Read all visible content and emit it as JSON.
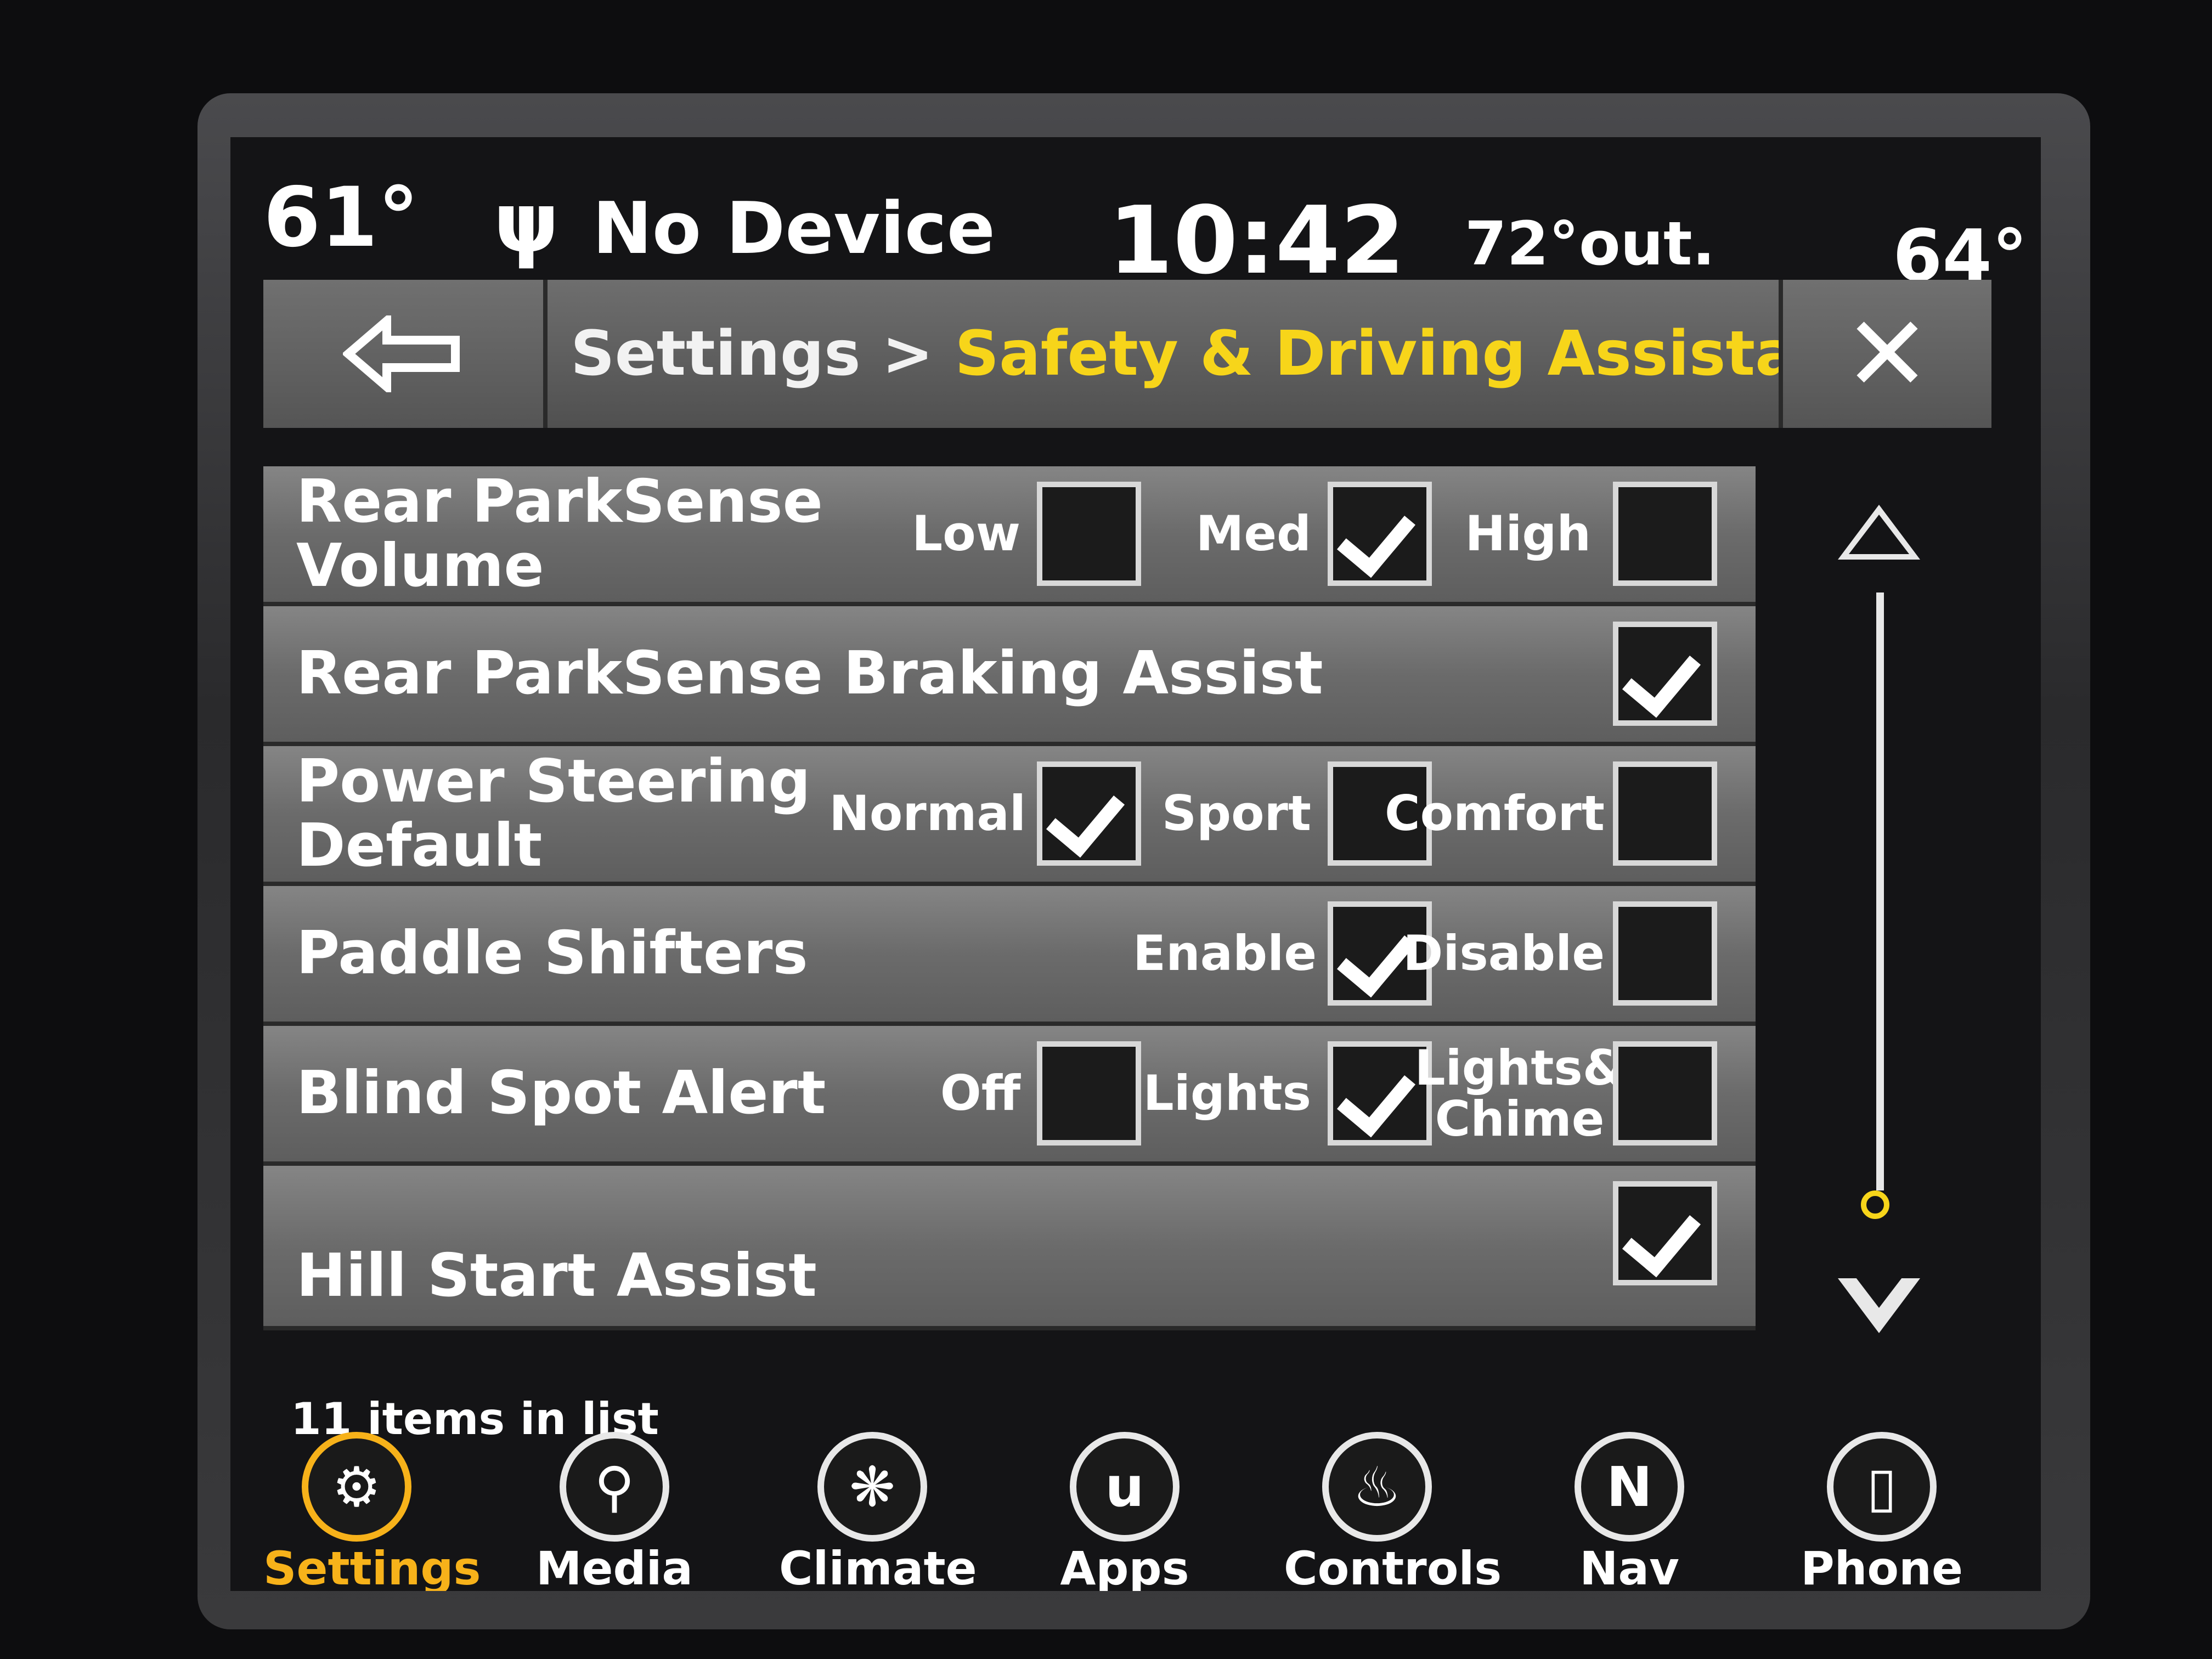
{
  "status": {
    "inside_temp_left": "61°",
    "usb_icon": "usb-icon",
    "device": "No Device",
    "time": "10:42",
    "outside_temp": "72°out.",
    "inside_temp_right": "64°"
  },
  "header": {
    "back_icon": "back-arrow-icon",
    "breadcrumb_root": "Settings",
    "breadcrumb_sep": " > ",
    "breadcrumb_current": "Safety & Driving Assistance",
    "close_icon": "close-icon",
    "close_glyph": "✕"
  },
  "colors": {
    "accent": "#f7d51a",
    "nav_active": "#f7b21a",
    "row": "#6b6b6b"
  },
  "rows": [
    {
      "label": "Rear ParkSense Volume",
      "options": [
        {
          "label": "Low",
          "checked": false
        },
        {
          "label": "Med",
          "checked": true
        },
        {
          "label": "High",
          "checked": false
        }
      ]
    },
    {
      "label": "Rear ParkSense Braking Assist",
      "options": [
        {
          "label": "",
          "checked": true
        }
      ]
    },
    {
      "label": "Power Steering Default",
      "options": [
        {
          "label": "Normal",
          "checked": true
        },
        {
          "label": "Sport",
          "checked": false
        },
        {
          "label": "Comfort",
          "checked": false
        }
      ]
    },
    {
      "label": "Paddle Shifters",
      "options": [
        {
          "label": "Enable",
          "checked": true
        },
        {
          "label": "Disable",
          "checked": false
        }
      ]
    },
    {
      "label": "Blind Spot Alert",
      "options": [
        {
          "label": "Off",
          "checked": false
        },
        {
          "label": "Lights",
          "checked": true
        },
        {
          "label": "Lights& Chime",
          "checked": false
        }
      ]
    },
    {
      "label": "Hill Start Assist",
      "options": [
        {
          "label": "",
          "checked": true
        }
      ]
    }
  ],
  "list_count": "11 items in list",
  "nav": [
    {
      "label": "Settings",
      "icon": "gear-icon",
      "glyph": "⚙",
      "active": true
    },
    {
      "label": "Media",
      "icon": "usb-icon",
      "glyph": "⚲",
      "active": false
    },
    {
      "label": "Climate",
      "icon": "climate-icon",
      "glyph": "❋",
      "active": false
    },
    {
      "label": "Apps",
      "icon": "apps-icon",
      "glyph": "u",
      "active": false
    },
    {
      "label": "Controls",
      "icon": "seat-icon",
      "glyph": "♨",
      "active": false
    },
    {
      "label": "Nav",
      "icon": "compass-icon",
      "glyph": "N",
      "active": false
    },
    {
      "label": "Phone",
      "icon": "phone-icon",
      "glyph": "▯",
      "active": false
    }
  ]
}
